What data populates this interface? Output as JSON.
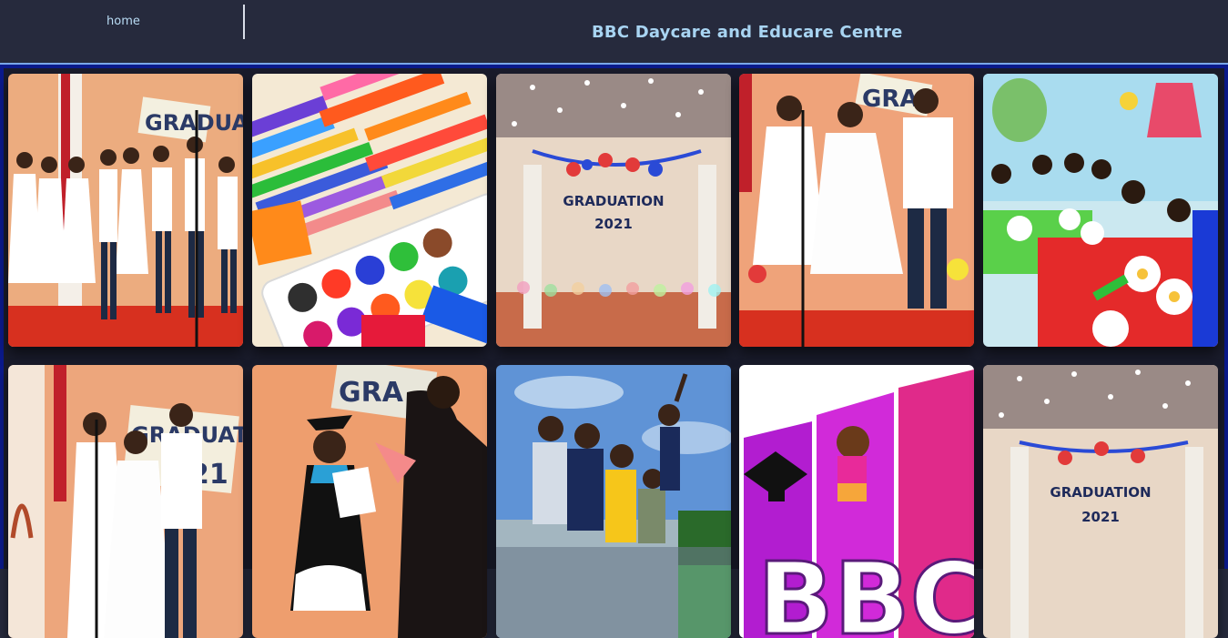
{
  "header": {
    "nav": {
      "home_label": "home"
    },
    "title": "BBC Daycare and Educare Centre"
  },
  "gallery": {
    "photos": [
      {
        "subject": "children-on-stage-graduation",
        "sign": "GRADUAT"
      },
      {
        "subject": "crayons-and-watercolor-palette"
      },
      {
        "subject": "graduation-banner-room",
        "sign_line1": "GRADUATION",
        "sign_line2": "2021"
      },
      {
        "subject": "children-singing-on-stage",
        "sign": "GRA"
      },
      {
        "subject": "children-crafting-at-table"
      },
      {
        "subject": "children-singing-graduation",
        "sign_line1": "GRADUATI",
        "sign_line2": "21"
      },
      {
        "subject": "graduate-receiving-certificate",
        "sign": "GRA"
      },
      {
        "subject": "children-sitting-outdoors"
      },
      {
        "subject": "bbc-logo-with-graduation-cap",
        "logo_text": "BBC"
      },
      {
        "subject": "graduation-banner-room",
        "sign_line1": "GRADUATION",
        "sign_line2": "2021"
      }
    ]
  },
  "colors": {
    "header_bg": "#262a3d",
    "title_text": "#a8d4f2",
    "nav_text": "#b9dcf5",
    "gallery_border": "#0b1a8c",
    "header_rule": "#7aa7e8"
  }
}
